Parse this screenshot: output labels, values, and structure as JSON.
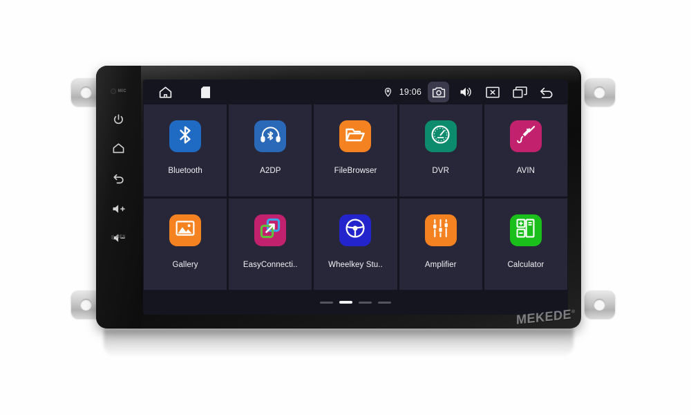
{
  "device": {
    "brand": "MEKEDE",
    "brand_mark": "®",
    "keypad": {
      "mic_label": "MIC",
      "reset_label": "RES",
      "buttons": [
        {
          "name": "power-button",
          "icon": "power-icon"
        },
        {
          "name": "home-button",
          "icon": "home-icon"
        },
        {
          "name": "back-button",
          "icon": "back-arrow-icon"
        },
        {
          "name": "volume-up-button",
          "icon": "volume-up-icon"
        },
        {
          "name": "volume-down-button",
          "icon": "volume-down-icon"
        }
      ]
    }
  },
  "statusbar": {
    "left_icons": [
      {
        "name": "home-icon",
        "label": "Home"
      },
      {
        "name": "sd-card-icon",
        "label": "SD Card"
      }
    ],
    "location_icon": "location-pin-icon",
    "time": "19:06",
    "right_icons": [
      {
        "name": "camera-icon",
        "label": "Camera",
        "highlighted": true
      },
      {
        "name": "volume-icon",
        "label": "Volume",
        "highlighted": false
      },
      {
        "name": "close-box-icon",
        "label": "Close",
        "highlighted": false
      },
      {
        "name": "recent-apps-icon",
        "label": "Recent Apps",
        "highlighted": false
      },
      {
        "name": "back-arrow-icon",
        "label": "Back",
        "highlighted": false
      }
    ]
  },
  "apps": [
    {
      "label": "Bluetooth",
      "icon": "bluetooth-icon",
      "color": "#1f6bc4"
    },
    {
      "label": "A2DP",
      "icon": "headphones-icon",
      "color": "#2a68b8"
    },
    {
      "label": "FileBrowser",
      "icon": "folder-icon",
      "color": "#f58220"
    },
    {
      "label": "DVR",
      "icon": "speedometer-icon",
      "color": "#0d8c6d"
    },
    {
      "label": "AVIN",
      "icon": "audio-plug-icon",
      "color": "#c2216e"
    },
    {
      "label": "Gallery",
      "icon": "image-icon",
      "color": "#f58220"
    },
    {
      "label": "EasyConnecti..",
      "icon": "screen-mirror-icon",
      "color": "#c2216e"
    },
    {
      "label": "Wheelkey Stu..",
      "icon": "steering-wheel-icon",
      "color": "#2424cc"
    },
    {
      "label": "Amplifier",
      "icon": "equalizer-icon",
      "color": "#f58220"
    },
    {
      "label": "Calculator",
      "icon": "calculator-icon",
      "color": "#1bbf1b"
    }
  ],
  "pager": {
    "total": 4,
    "active_index": 1
  },
  "colors": {
    "screen_background": "#15151f",
    "tile_background": "#272739",
    "text_primary": "#f2f2f5",
    "highlight": "#3a3a4c"
  }
}
